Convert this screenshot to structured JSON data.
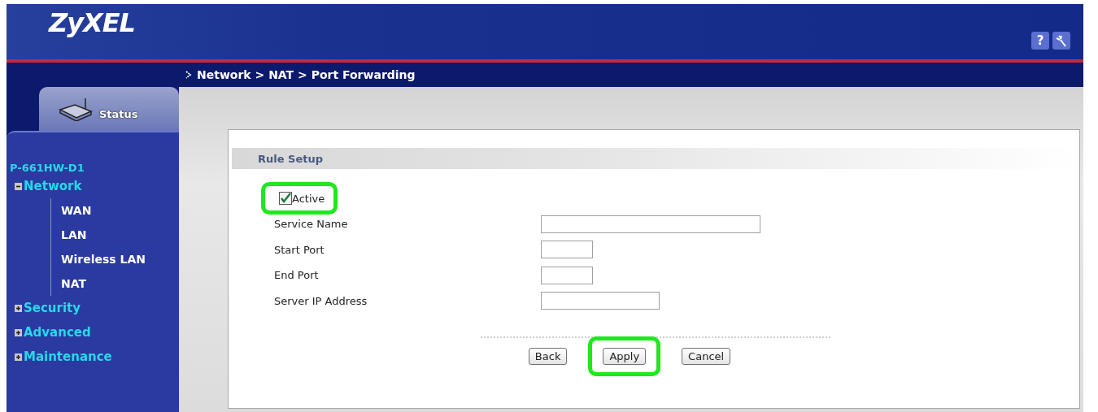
{
  "header": {
    "logo": "ZyXEL",
    "help_button": "?"
  },
  "sidebar": {
    "status_tab": "Status",
    "tree": {
      "label": "P-661HW-D1",
      "children": [
        {
          "label": "Network",
          "expanded": true,
          "children": [
            {
              "label": "WAN"
            },
            {
              "label": "LAN"
            },
            {
              "label": "Wireless LAN"
            },
            {
              "label": "NAT"
            }
          ]
        },
        {
          "label": "Security",
          "expanded": false
        },
        {
          "label": "Advanced",
          "expanded": false
        },
        {
          "label": "Maintenance",
          "expanded": false
        }
      ]
    }
  },
  "breadcrumb": "Network > NAT > Port Forwarding",
  "panel": {
    "title": "Rule Setup",
    "active": {
      "label": "Active",
      "checked": true,
      "highlighted": true
    },
    "fields": [
      {
        "label": "Service Name"
      },
      {
        "label": "Start Port"
      },
      {
        "label": "End Port"
      },
      {
        "label": "Server IP Address"
      }
    ],
    "buttons": [
      {
        "label": "Back",
        "highlighted": false
      },
      {
        "label": "Apply",
        "highlighted": true
      },
      {
        "label": "Cancel",
        "highlighted": false
      }
    ]
  }
}
